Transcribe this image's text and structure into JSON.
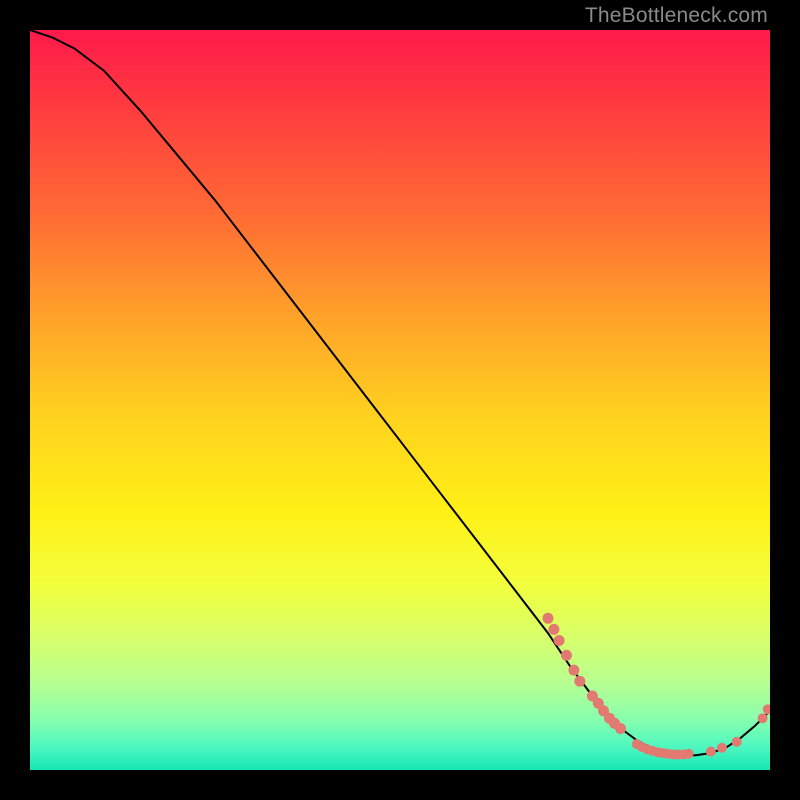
{
  "watermark": "TheBottleneck.com",
  "colors": {
    "curve": "#000000",
    "marker_fill": "#e27a72",
    "marker_stroke": "#e27a72"
  },
  "chart_data": {
    "type": "line",
    "title": "",
    "xlabel": "",
    "ylabel": "",
    "xlim": [
      0,
      100
    ],
    "ylim": [
      0,
      100
    ],
    "grid": false,
    "legend": false,
    "series": [
      {
        "name": "curve",
        "x": [
          0,
          3,
          6,
          10,
          15,
          20,
          25,
          30,
          35,
          40,
          45,
          50,
          55,
          60,
          65,
          70,
          73,
          76,
          78,
          80,
          82,
          84,
          86,
          88,
          90,
          92,
          94,
          96,
          98,
          100
        ],
        "y": [
          100,
          99,
          97.5,
          94.5,
          89,
          83,
          77,
          70.5,
          64,
          57.5,
          51,
          44.5,
          38,
          31.5,
          25,
          18.5,
          14,
          10,
          7.5,
          5.5,
          4,
          3,
          2.3,
          2,
          2,
          2.3,
          3,
          4.3,
          6,
          8
        ]
      }
    ],
    "markers": [
      {
        "x": 70.0,
        "y": 20.5,
        "r": 5
      },
      {
        "x": 70.8,
        "y": 19.0,
        "r": 5
      },
      {
        "x": 71.5,
        "y": 17.5,
        "r": 5
      },
      {
        "x": 72.5,
        "y": 15.5,
        "r": 5
      },
      {
        "x": 73.5,
        "y": 13.5,
        "r": 5
      },
      {
        "x": 74.3,
        "y": 12.0,
        "r": 5
      },
      {
        "x": 76.0,
        "y": 10.0,
        "r": 5
      },
      {
        "x": 76.8,
        "y": 9.0,
        "r": 5
      },
      {
        "x": 77.5,
        "y": 8.0,
        "r": 5
      },
      {
        "x": 78.3,
        "y": 7.0,
        "r": 5
      },
      {
        "x": 79.0,
        "y": 6.3,
        "r": 5
      },
      {
        "x": 79.8,
        "y": 5.6,
        "r": 5
      },
      {
        "x": 82.0,
        "y": 3.5,
        "r": 4.5
      },
      {
        "x": 82.7,
        "y": 3.1,
        "r": 4.5
      },
      {
        "x": 83.4,
        "y": 2.8,
        "r": 4.5
      },
      {
        "x": 84.1,
        "y": 2.6,
        "r": 4.5
      },
      {
        "x": 84.8,
        "y": 2.4,
        "r": 4.5
      },
      {
        "x": 85.5,
        "y": 2.3,
        "r": 4.5
      },
      {
        "x": 86.2,
        "y": 2.2,
        "r": 4.5
      },
      {
        "x": 86.9,
        "y": 2.1,
        "r": 4.5
      },
      {
        "x": 87.6,
        "y": 2.1,
        "r": 4.5
      },
      {
        "x": 88.3,
        "y": 2.1,
        "r": 4.5
      },
      {
        "x": 89.0,
        "y": 2.2,
        "r": 4.5
      },
      {
        "x": 92.0,
        "y": 2.5,
        "r": 4.5
      },
      {
        "x": 93.5,
        "y": 3.0,
        "r": 4.5
      },
      {
        "x": 95.5,
        "y": 3.8,
        "r": 4.5
      },
      {
        "x": 99.0,
        "y": 7.0,
        "r": 4.5
      },
      {
        "x": 99.7,
        "y": 8.2,
        "r": 4.5
      }
    ]
  }
}
